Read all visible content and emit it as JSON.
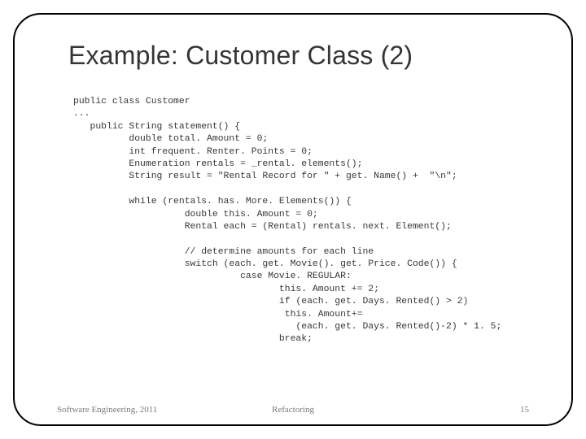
{
  "title": "Example: Customer Class (2)",
  "code": "public class Customer\n...\n   public String statement() {\n          double total. Amount = 0;\n          int frequent. Renter. Points = 0;\n          Enumeration rentals = _rental. elements();\n          String result = \"Rental Record for \" + get. Name() +  \"\\n\";\n\n          while (rentals. has. More. Elements()) {\n                    double this. Amount = 0;\n                    Rental each = (Rental) rentals. next. Element();\n\n                    // determine amounts for each line\n                    switch (each. get. Movie(). get. Price. Code()) {\n                              case Movie. REGULAR:\n                                     this. Amount += 2;\n                                     if (each. get. Days. Rented() > 2)\n                                      this. Amount+=\n                                        (each. get. Days. Rented()-2) * 1. 5;\n                                     break;",
  "footer": {
    "left": "Software Engineering, 2011",
    "center": "Refactoring",
    "right": "15"
  }
}
